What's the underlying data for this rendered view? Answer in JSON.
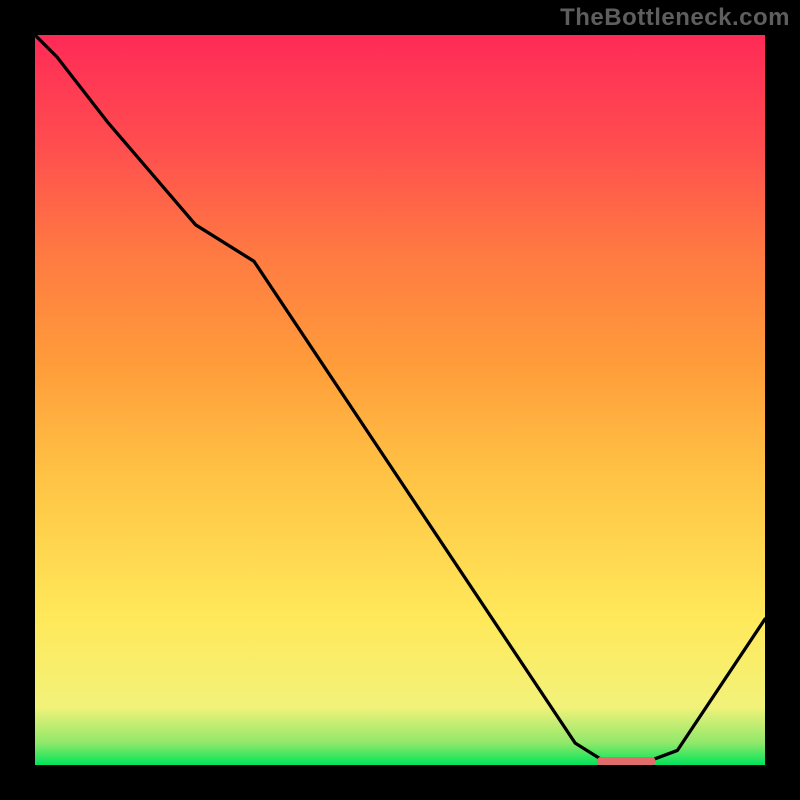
{
  "watermark": "TheBottleneck.com",
  "chart_data": {
    "type": "line",
    "title": "",
    "xlabel": "",
    "ylabel": "",
    "xlim": [
      0,
      100
    ],
    "ylim": [
      0,
      100
    ],
    "background_gradient": {
      "stops": [
        {
          "pos": 0.0,
          "color": "#00e45a"
        },
        {
          "pos": 0.03,
          "color": "#8fe86a"
        },
        {
          "pos": 0.08,
          "color": "#f2f27a"
        },
        {
          "pos": 0.2,
          "color": "#ffe95a"
        },
        {
          "pos": 0.4,
          "color": "#ffc244"
        },
        {
          "pos": 0.55,
          "color": "#ff9c3a"
        },
        {
          "pos": 0.7,
          "color": "#ff7a42"
        },
        {
          "pos": 0.85,
          "color": "#ff4d4f"
        },
        {
          "pos": 1.0,
          "color": "#ff2a57"
        }
      ]
    },
    "curve": {
      "x": [
        0,
        3,
        10,
        22,
        30,
        74,
        78,
        84,
        88,
        100
      ],
      "y": [
        100,
        97,
        88,
        74,
        69,
        3,
        0.5,
        0.5,
        2,
        20
      ]
    },
    "optimum_marker": {
      "center_x": 81,
      "y": 0.5,
      "half_width": 4,
      "color": "#e06d6a"
    }
  }
}
